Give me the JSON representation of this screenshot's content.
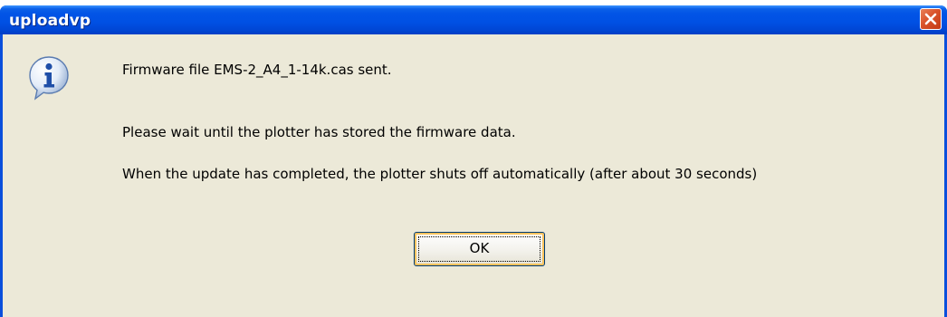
{
  "window": {
    "title": "uploadvp",
    "close_icon": "close-icon",
    "info_icon": "information-icon"
  },
  "message": {
    "line1": "Firmware file EMS-2_A4_1-14k.cas  sent.",
    "line2": "Please wait until the plotter has stored the firmware data.",
    "line3": "When the update has completed, the plotter shuts off automatically (after about 30 seconds)"
  },
  "buttons": {
    "ok_label": "OK"
  },
  "colors": {
    "title_bar": "#0054e3",
    "dialog_background": "#ece9d8",
    "close_button": "#d9522a"
  }
}
